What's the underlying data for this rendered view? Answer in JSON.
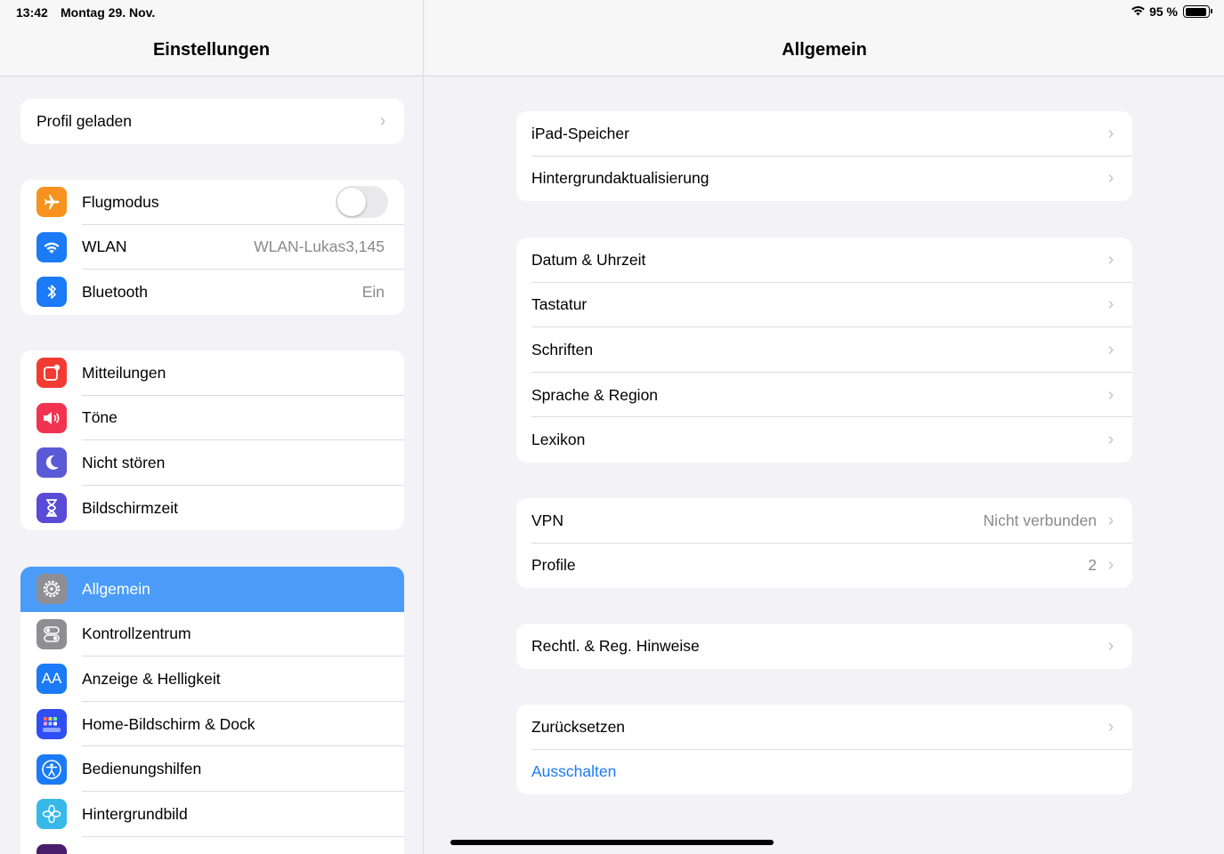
{
  "status": {
    "time": "13:42",
    "date": "Montag 29. Nov.",
    "battery": "95 %",
    "battery_level": 0.95
  },
  "sidebar": {
    "title": "Einstellungen",
    "profile": {
      "label": "Profil geladen"
    },
    "connectivity": [
      {
        "label": "Flugmodus",
        "icon": "airplane-icon",
        "color": "#f7921e",
        "toggle": false
      },
      {
        "label": "WLAN",
        "icon": "wifi-icon",
        "color": "#1b7af5",
        "value": "WLAN-Lukas3,145"
      },
      {
        "label": "Bluetooth",
        "icon": "bluetooth-icon",
        "color": "#1b7af5",
        "value": "Ein"
      }
    ],
    "notifications": [
      {
        "label": "Mitteilungen",
        "icon": "notifications-icon",
        "color": "#f23b32"
      },
      {
        "label": "Töne",
        "icon": "sound-icon",
        "color": "#f2334f"
      },
      {
        "label": "Nicht stören",
        "icon": "moon-icon",
        "color": "#5a5ad6"
      },
      {
        "label": "Bildschirmzeit",
        "icon": "hourglass-icon",
        "color": "#5a4bd6"
      }
    ],
    "general": [
      {
        "label": "Allgemein",
        "icon": "gear-icon",
        "color": "#8e8e93",
        "selected": true
      },
      {
        "label": "Kontrollzentrum",
        "icon": "switches-icon",
        "color": "#8e8e93"
      },
      {
        "label": "Anzeige & Helligkeit",
        "icon": "text-size-icon",
        "color": "#1b7af5",
        "glyph": "AA"
      },
      {
        "label": "Home-Bildschirm & Dock",
        "icon": "grid-icon",
        "color": "#2f4ef5"
      },
      {
        "label": "Bedienungshilfen",
        "icon": "accessibility-icon",
        "color": "#1b7af5"
      },
      {
        "label": "Hintergrundbild",
        "icon": "flower-icon",
        "color": "#38b8e8"
      }
    ]
  },
  "detail": {
    "title": "Allgemein",
    "group1": [
      {
        "label": "iPad-Speicher"
      },
      {
        "label": "Hintergrundaktualisierung"
      }
    ],
    "group2": [
      {
        "label": "Datum & Uhrzeit"
      },
      {
        "label": "Tastatur"
      },
      {
        "label": "Schriften"
      },
      {
        "label": "Sprache & Region"
      },
      {
        "label": "Lexikon"
      }
    ],
    "group3": [
      {
        "label": "VPN",
        "value": "Nicht verbunden"
      },
      {
        "label": "Profile",
        "value": "2"
      }
    ],
    "group4": [
      {
        "label": "Rechtl. & Reg. Hinweise"
      }
    ],
    "group5": [
      {
        "label": "Zurücksetzen"
      },
      {
        "label": "Ausschalten"
      }
    ]
  }
}
